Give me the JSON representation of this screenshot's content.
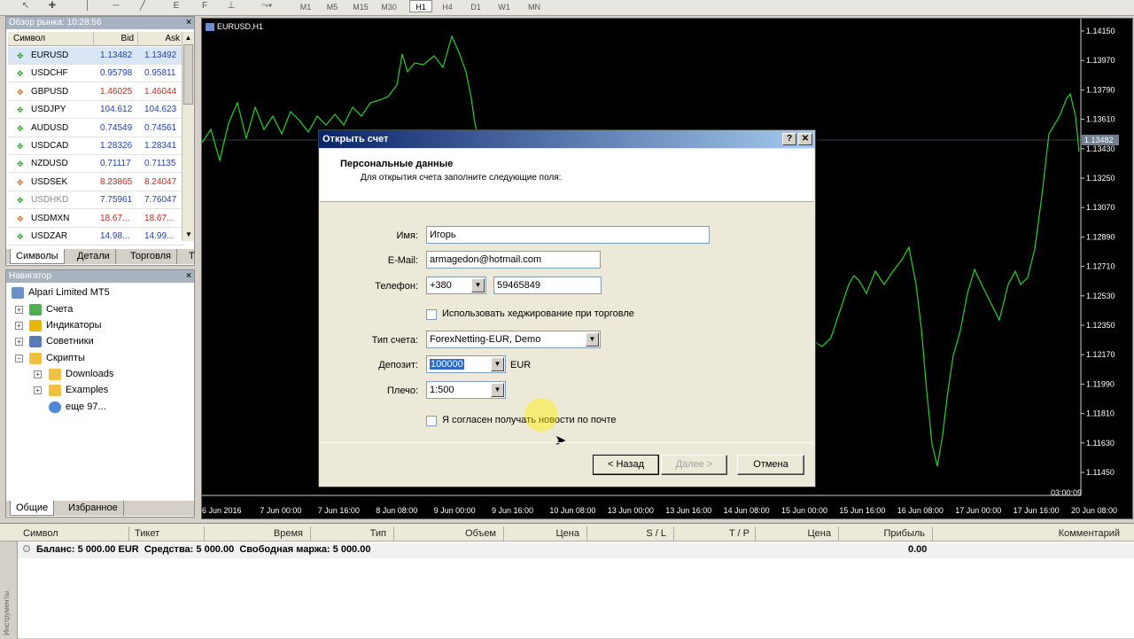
{
  "toolbar": {
    "timeframes": [
      "M1",
      "M5",
      "M15",
      "M30",
      "H1",
      "H4",
      "D1",
      "W1",
      "MN"
    ],
    "active_timeframe": "H1",
    "tool_labels": {
      "e": "E",
      "f": "F"
    }
  },
  "market_watch": {
    "title": "Обзор рынка: 10:28:56",
    "columns": {
      "symbol": "Символ",
      "bid": "Bid",
      "ask": "Ask"
    },
    "rows": [
      {
        "symbol": "EURUSD",
        "bid": "1.13482",
        "ask": "1.13492",
        "dir": "up"
      },
      {
        "symbol": "USDCHF",
        "bid": "0.95798",
        "ask": "0.95811",
        "dir": "up"
      },
      {
        "symbol": "GBPUSD",
        "bid": "1.46025",
        "ask": "1.46044",
        "dir": "down"
      },
      {
        "symbol": "USDJPY",
        "bid": "104.612",
        "ask": "104.623",
        "dir": "up"
      },
      {
        "symbol": "AUDUSD",
        "bid": "0.74549",
        "ask": "0.74561",
        "dir": "up"
      },
      {
        "symbol": "USDCAD",
        "bid": "1.28326",
        "ask": "1.28341",
        "dir": "up"
      },
      {
        "symbol": "NZDUSD",
        "bid": "0.71117",
        "ask": "0.71135",
        "dir": "up"
      },
      {
        "symbol": "USDSEK",
        "bid": "8.23865",
        "ask": "8.24047",
        "dir": "down"
      },
      {
        "symbol": "USDHKD",
        "bid": "7.75961",
        "ask": "7.76047",
        "dir": "up"
      },
      {
        "symbol": "USDMXN",
        "bid": "18.67...",
        "ask": "18.67...",
        "dir": "down"
      },
      {
        "symbol": "USDZAR",
        "bid": "14.98...",
        "ask": "14.99...",
        "dir": "up"
      }
    ],
    "tabs": [
      "Символы",
      "Детали",
      "Торговля",
      "Т"
    ]
  },
  "navigator": {
    "title": "Навигатор",
    "root": "Alpari Limited MT5",
    "items": [
      "Счета",
      "Индикаторы",
      "Советники",
      "Скрипты"
    ],
    "sub_items": [
      "Downloads",
      "Examples",
      "еще 97..."
    ],
    "tabs": [
      "Общие",
      "Избранное"
    ]
  },
  "chart": {
    "title": "EURUSD,H1",
    "price_labels": [
      "1.14150",
      "1.13970",
      "1.13790",
      "1.13610",
      "1.13430",
      "1.13250",
      "1.13070",
      "1.12890",
      "1.12710",
      "1.12530",
      "1.12350",
      "1.12170",
      "1.11990",
      "1.11810",
      "1.11630",
      "1.11450"
    ],
    "current_price": "1.13482",
    "time_labels": [
      "6 Jun 2016",
      "7 Jun 00:00",
      "7 Jun 16:00",
      "8 Jun 08:00",
      "9 Jun 00:00",
      "9 Jun 16:00",
      "10 Jun 08:00",
      "13 Jun 00:00",
      "13 Jun 16:00",
      "14 Jun 08:00",
      "15 Jun 00:00",
      "15 Jun 16:00",
      "16 Jun 08:00",
      "17 Jun 00:00",
      "17 Jun 16:00",
      "20 Jun 08:00"
    ],
    "time_corner": "03:00:09",
    "line_color": "#2ad12a"
  },
  "dialog": {
    "title": "Открыть счет",
    "help": "?",
    "close": "✕",
    "heading": "Персональные данные",
    "subheading": "Для открытия счета заполните следующие поля:",
    "name_label": "Имя:",
    "name_value": "Игорь",
    "email_label": "E-Mail:",
    "email_value": "armagedon@hotmail.com",
    "phone_label": "Телефон:",
    "phone_code": "+380",
    "phone_value": "59465849",
    "hedge_label": "Использовать хеджирование при торговле",
    "account_type_label": "Тип счета:",
    "account_type_value": "ForexNetting-EUR, Demo",
    "deposit_label": "Депозит:",
    "deposit_value": "100000",
    "deposit_currency": "EUR",
    "leverage_label": "Плечо:",
    "leverage_value": "1:500",
    "news_label": "Я согласен получать новости по почте",
    "back_button": "< Назад",
    "next_button": "Далее >",
    "cancel_button": "Отмена"
  },
  "terminal": {
    "columns": [
      "Символ",
      "Тикет",
      "Время",
      "Тип",
      "Объем",
      "Цена",
      "S / L",
      "T / P",
      "Цена",
      "Прибыль",
      "Комментарий"
    ],
    "balance_line": "Баланс: 5 000.00 EUR  Средства: 5 000.00  Свободная маржа: 5 000.00",
    "profit": "0.00",
    "side_label": "Инструменты"
  }
}
